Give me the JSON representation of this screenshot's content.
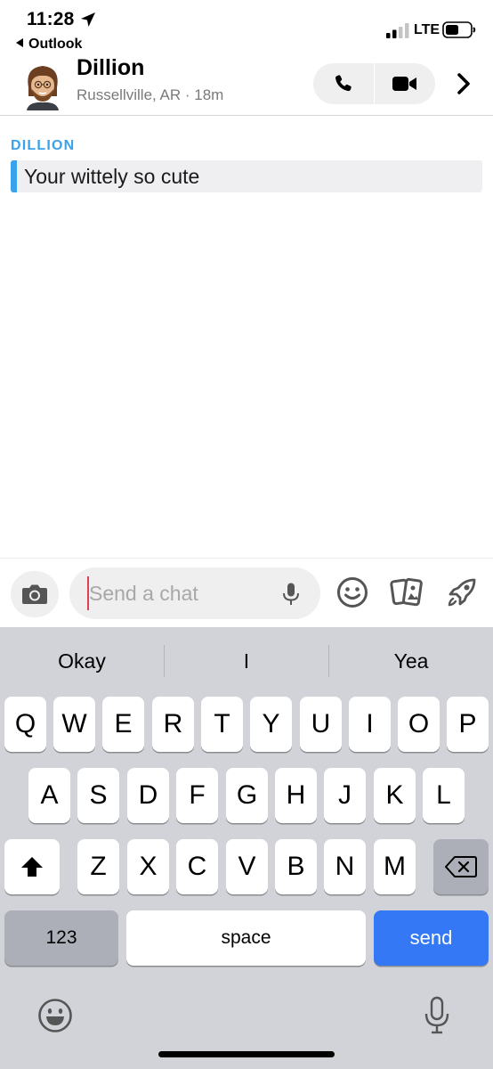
{
  "status_bar": {
    "time": "11:28",
    "back_app": "Outlook",
    "network": "LTE"
  },
  "header": {
    "name": "Dillion",
    "subtitle": "Russellville, AR · 18m"
  },
  "messages": [
    {
      "sender": "DILLION",
      "text": "Your wittely so cute"
    }
  ],
  "composer": {
    "placeholder": "Send a chat",
    "value": ""
  },
  "keyboard": {
    "suggestions": [
      "Okay",
      "I",
      "Yea"
    ],
    "row1": [
      "Q",
      "W",
      "E",
      "R",
      "T",
      "Y",
      "U",
      "I",
      "O",
      "P"
    ],
    "row2": [
      "A",
      "S",
      "D",
      "F",
      "G",
      "H",
      "J",
      "K",
      "L"
    ],
    "row3": [
      "Z",
      "X",
      "C",
      "V",
      "B",
      "N",
      "M"
    ],
    "numbers_label": "123",
    "space_label": "space",
    "send_label": "send"
  },
  "colors": {
    "accent_blue": "#3aa2ec",
    "send_blue": "#3478f6",
    "caret_red": "#e0404f"
  }
}
